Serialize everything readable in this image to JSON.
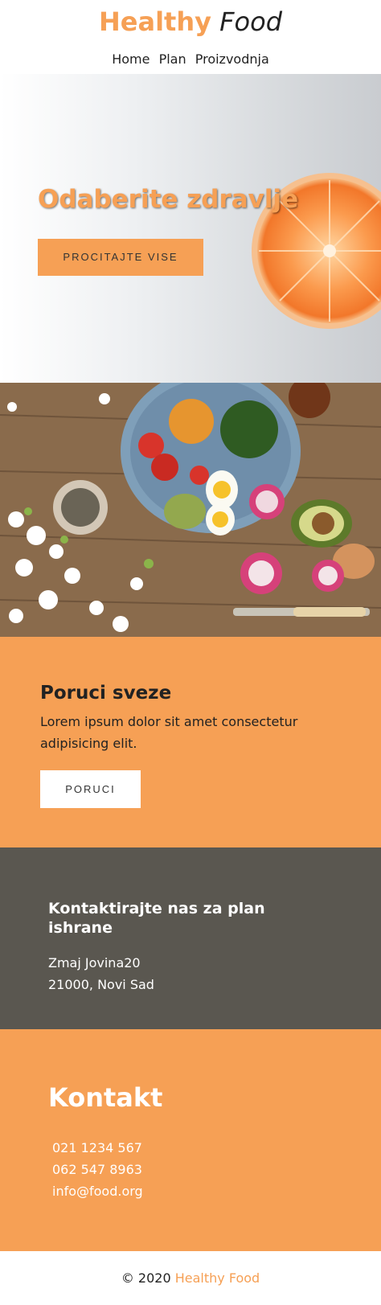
{
  "header": {
    "logo_brand": "Healthy",
    "logo_food": "Food",
    "nav": [
      "Home",
      "Plan",
      "Proizvodnja"
    ]
  },
  "hero": {
    "title": "Odaberite zdravlje",
    "button_label": "PROCITAJTE VISE"
  },
  "order": {
    "title": "Poruci sveze",
    "text": "Lorem ipsum dolor sit amet consectetur adipisicing elit.",
    "button_label": "PORUCI"
  },
  "contact_plan": {
    "title": "Kontaktirajte nas za plan ishrane",
    "address_line1": "Zmaj Jovina20",
    "address_line2": "21000, Novi Sad"
  },
  "contact": {
    "title": "Kontakt",
    "phone1": "021 1234 567",
    "phone2": "062 547 8963",
    "email": "info@food.org"
  },
  "footer": {
    "copyright": "© 2020",
    "brand": "Healthy Food"
  },
  "colors": {
    "accent": "#f6a055",
    "dark_section": "#5a5750"
  }
}
